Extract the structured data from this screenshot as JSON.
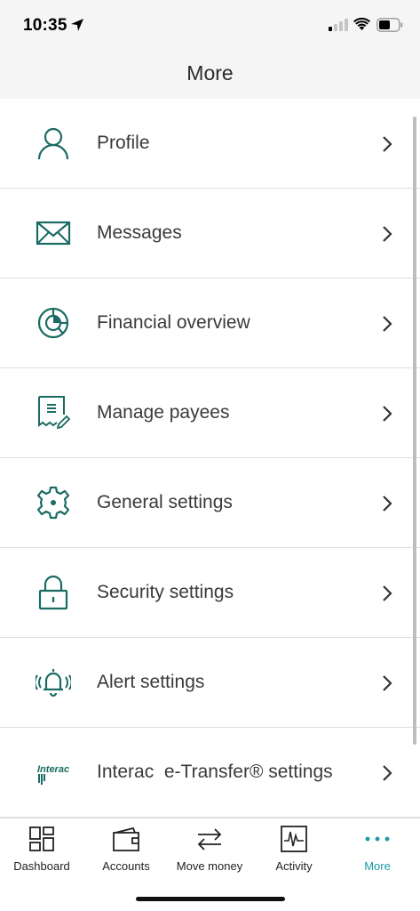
{
  "status_bar": {
    "time": "10:35"
  },
  "header": {
    "title": "More"
  },
  "menu": {
    "items": [
      {
        "label": "Profile",
        "icon": "person-icon"
      },
      {
        "label": "Messages",
        "icon": "envelope-icon"
      },
      {
        "label": "Financial overview",
        "icon": "pie-chart-icon"
      },
      {
        "label": "Manage payees",
        "icon": "receipt-icon"
      },
      {
        "label": "General settings",
        "icon": "gear-icon"
      },
      {
        "label": "Security settings",
        "icon": "padlock-icon"
      },
      {
        "label": "Alert settings",
        "icon": "bell-icon"
      },
      {
        "label": "Interac  e-Transfer® settings",
        "icon": "interac-logo",
        "logo_text": "Interac"
      }
    ]
  },
  "tabbar": {
    "tabs": [
      {
        "label": "Dashboard",
        "icon": "dashboard-icon"
      },
      {
        "label": "Accounts",
        "icon": "wallet-icon"
      },
      {
        "label": "Move money",
        "icon": "transfer-arrows-icon"
      },
      {
        "label": "Activity",
        "icon": "activity-chart-icon"
      },
      {
        "label": "More",
        "icon": "more-dots-icon",
        "active": true
      }
    ]
  },
  "colors": {
    "accent": "#1a6b63",
    "tab_active": "#1a9aa6",
    "header_bg": "#f5f5f5",
    "divider": "#dedede"
  }
}
